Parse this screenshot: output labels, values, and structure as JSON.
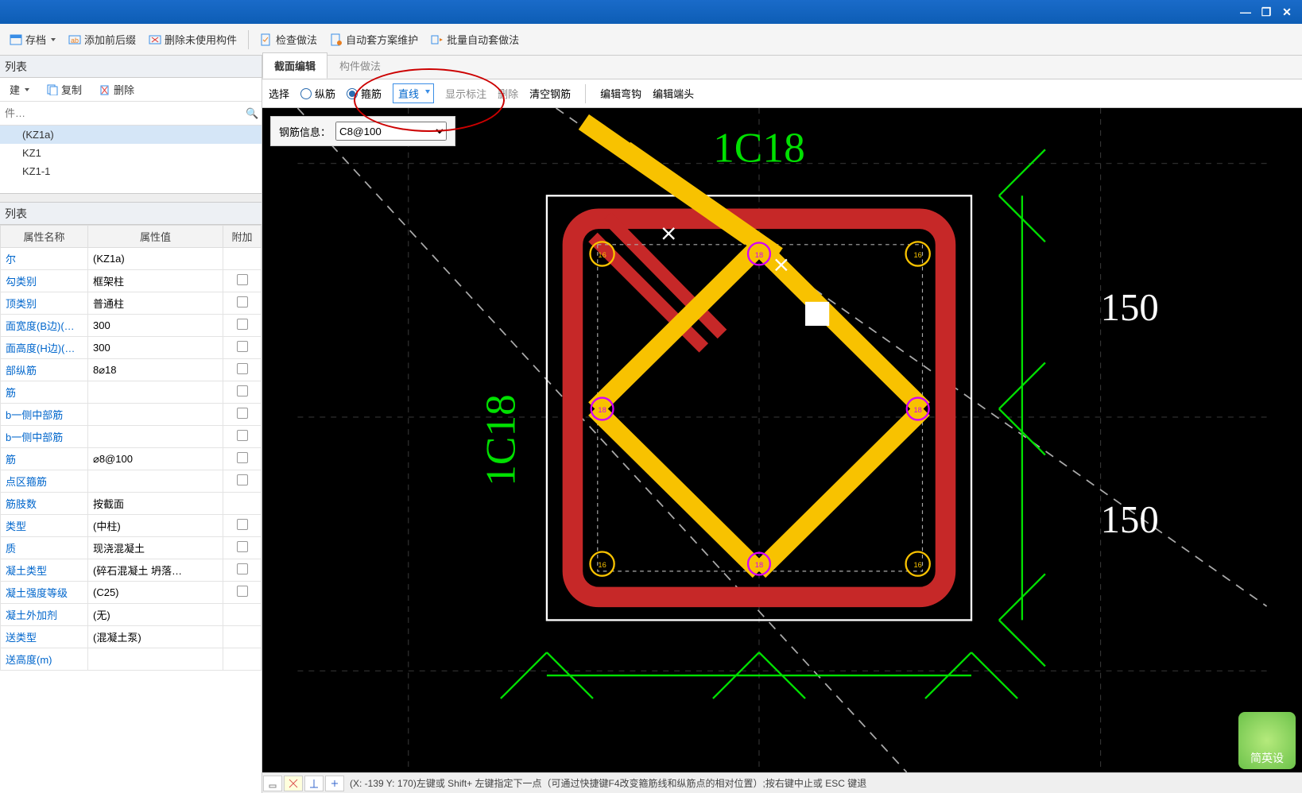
{
  "window": {
    "min": "—",
    "restore": "❐",
    "close": "✕"
  },
  "toolbar": {
    "btn1": "存档",
    "btn2": "添加前后缀",
    "btn3": "删除未使用构件",
    "btn4": "检查做法",
    "btn5": "自动套方案维护",
    "btn6": "批量自动套做法"
  },
  "leftpanel": {
    "hdr1": "列表",
    "sub": {
      "new": "建",
      "copy": "复制",
      "del": "删除"
    },
    "search_ph": "件…",
    "items": [
      "(KZ1a)",
      "KZ1",
      "KZ1-1"
    ],
    "hdr2": "列表",
    "cols": {
      "c1": "属性名称",
      "c2": "属性值",
      "c3": "附加"
    },
    "props": [
      {
        "n": "尔",
        "v": "(KZ1a)",
        "c": false,
        "link": true
      },
      {
        "n": "勾类别",
        "v": "框架柱",
        "c": true,
        "link": true
      },
      {
        "n": "顶类别",
        "v": "普通柱",
        "c": true,
        "link": true
      },
      {
        "n": "面宽度(B边)(…",
        "v": "300",
        "c": true,
        "link": true
      },
      {
        "n": "面高度(H边)(…",
        "v": "300",
        "c": true,
        "link": true
      },
      {
        "n": "部纵筋",
        "v": "8⌀18",
        "c": true,
        "link": true
      },
      {
        "n": "筋",
        "v": "",
        "c": true,
        "link": true
      },
      {
        "n": "b一侧中部筋",
        "v": "",
        "c": true,
        "link": true
      },
      {
        "n": "b一侧中部筋",
        "v": "",
        "c": true,
        "link": true
      },
      {
        "n": "筋",
        "v": "⌀8@100",
        "c": true,
        "link": true
      },
      {
        "n": "点区箍筋",
        "v": "",
        "c": true,
        "link": true
      },
      {
        "n": "筋肢数",
        "v": "按截面",
        "c": false,
        "link": true
      },
      {
        "n": "类型",
        "v": "(中柱)",
        "c": true,
        "link": true
      },
      {
        "n": "质",
        "v": "现浇混凝土",
        "c": true,
        "link": true
      },
      {
        "n": "凝土类型",
        "v": "(碎石混凝土 坍落…",
        "c": true,
        "link": true
      },
      {
        "n": "凝土强度等级",
        "v": "(C25)",
        "c": true,
        "link": true
      },
      {
        "n": "凝土外加剂",
        "v": "(无)",
        "c": false,
        "link": true
      },
      {
        "n": "送类型",
        "v": "(混凝土泵)",
        "c": false,
        "link": true
      },
      {
        "n": "送高度(m)",
        "v": "",
        "c": false,
        "link": true
      }
    ]
  },
  "right": {
    "tab1": "截面编辑",
    "tab2": "构件做法",
    "tools": {
      "sel": "选择",
      "rb1": "纵筋",
      "rb2": "箍筋",
      "drop": "直线",
      "show": "显示标注",
      "del": "删除",
      "clr": "清空钢筋",
      "hook": "编辑弯钩",
      "end": "编辑端头"
    },
    "info_label": "钢筋信息：",
    "info_val": "C8@100",
    "labels": {
      "top": "1C18",
      "left": "1C18",
      "d1": "150",
      "d2": "150"
    },
    "status": "(X: -139 Y: 170)左键或 Shift+ 左键指定下一点（可通过快捷键F4改变箍筋线和纵筋点的相对位置）;按右键中止或 ESC 键退",
    "wm": "简英设"
  }
}
